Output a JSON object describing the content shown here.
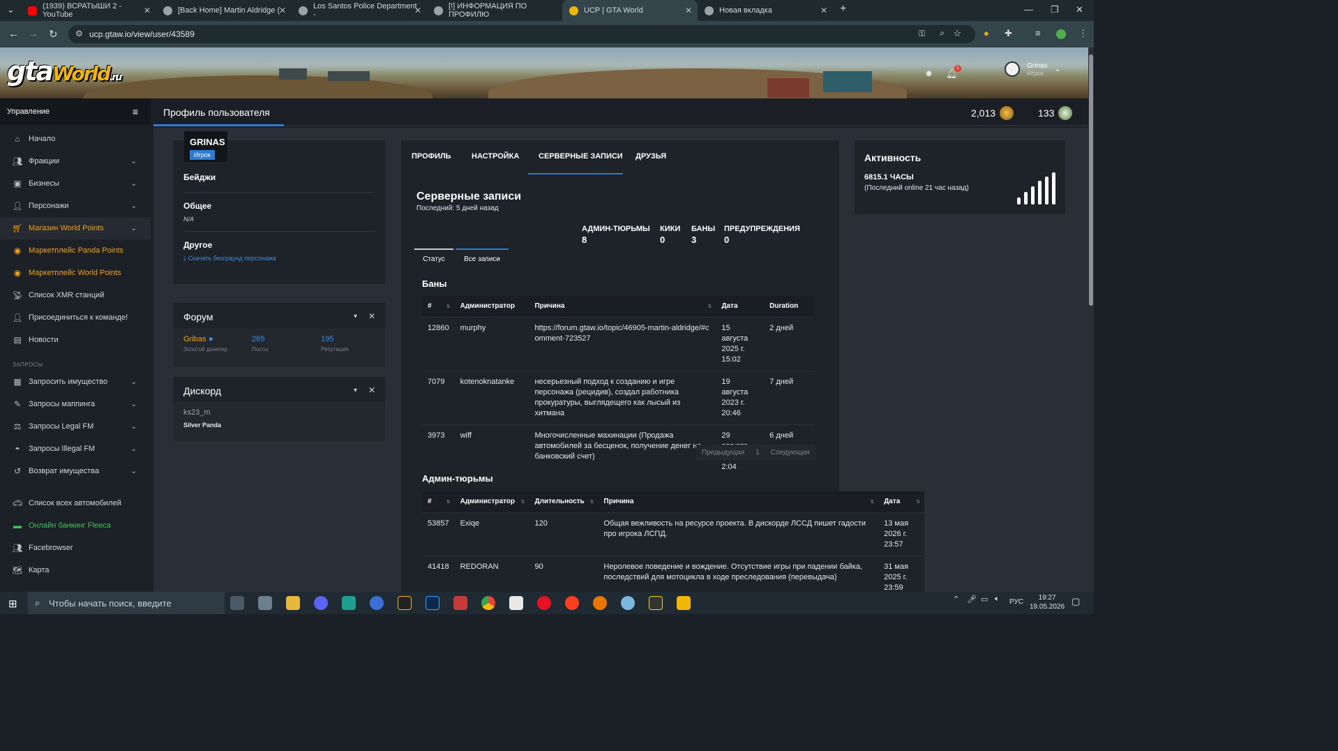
{
  "browser": {
    "tabs": [
      {
        "title": "(1939) ВСРАТЫШИ 2 - YouTube",
        "color": "#ff0000"
      },
      {
        "title": "[Back Home] Martin Aldridge (",
        "color": "#888888"
      },
      {
        "title": "Los Santos Police Department -",
        "color": "#888888"
      },
      {
        "title": "[!] ИНФОРМАЦИЯ ПО ПРОФИЛЮ",
        "color": "#888888"
      },
      {
        "title": "UCP | GTA World",
        "color": "#f2b705"
      },
      {
        "title": "Новая вкладка",
        "color": "#888888"
      }
    ],
    "url": "ucp.gtaw.io/view/user/43589"
  },
  "header": {
    "logo_main": "gta",
    "logo_world": "World",
    "logo_ru": ".ru",
    "notification_count": "1",
    "user_name": "Grinas",
    "user_role": "Игрок"
  },
  "sidebar": {
    "title": "Управление",
    "items": [
      {
        "label": "Начало",
        "icon": "home-icon",
        "chevron": false,
        "style": "normal"
      },
      {
        "label": "Фракции",
        "icon": "users-icon",
        "chevron": true,
        "style": "normal"
      },
      {
        "label": "Бизнесы",
        "icon": "briefcase-icon",
        "chevron": true,
        "style": "normal"
      },
      {
        "label": "Персонажи",
        "icon": "user-icon",
        "chevron": true,
        "style": "normal"
      },
      {
        "label": "Магазин World Points",
        "icon": "cart-icon",
        "chevron": true,
        "style": "orange"
      },
      {
        "label": "Маркетплейс Panda Points",
        "icon": "coins-icon",
        "chevron": false,
        "style": "orange"
      },
      {
        "label": "Маркетплейс World Points",
        "icon": "coins-icon",
        "chevron": false,
        "style": "orange"
      },
      {
        "label": "Список XMR станций",
        "icon": "antenna-icon",
        "chevron": false,
        "style": "normal"
      },
      {
        "label": "Присоединиться к команде!",
        "icon": "user-plus-icon",
        "chevron": false,
        "style": "normal"
      },
      {
        "label": "Новости",
        "icon": "newspaper-icon",
        "chevron": false,
        "style": "normal"
      }
    ],
    "section_requests": "ЗАПРОСЫ",
    "request_items": [
      {
        "label": "Запросить имущество",
        "icon": "building-icon",
        "chevron": true,
        "style": "normal"
      },
      {
        "label": "Запросы маппинга",
        "icon": "brush-icon",
        "chevron": true,
        "style": "normal"
      },
      {
        "label": "Запросы Legal FM",
        "icon": "scale-icon",
        "chevron": true,
        "style": "normal"
      },
      {
        "label": "Запросы Illegal FM",
        "icon": "mask-icon",
        "chevron": true,
        "style": "normal"
      },
      {
        "label": "Возврат имущества",
        "icon": "undo-icon",
        "chevron": true,
        "style": "normal"
      }
    ],
    "bottom_items": [
      {
        "label": "Список всех автомобилей",
        "icon": "car-icon",
        "style": "normal"
      },
      {
        "label": "Онлайн банкинг Fleeca",
        "icon": "money-icon",
        "style": "green"
      },
      {
        "label": "Facebrowser",
        "icon": "users-icon",
        "style": "normal"
      },
      {
        "label": "Карта",
        "icon": "map-icon",
        "style": "normal"
      }
    ]
  },
  "topbar": {
    "title": "Профиль пользователя",
    "world_points": "2,013",
    "panda_points": "133"
  },
  "profile": {
    "username": "GRINAS",
    "role": "Игрок",
    "badges_label": "Бейджи",
    "general_label": "Общее",
    "general_value": "N/A",
    "other_label": "Другое",
    "download_link": "Скачать бекграунд персонажа"
  },
  "forum": {
    "title": "Форум",
    "name": "Gribas",
    "rank": "Золотой донатер",
    "posts_value": "265",
    "posts_label": "Посты",
    "rep_value": "195",
    "rep_label": "Репутация"
  },
  "discord": {
    "title": "Дискорд",
    "name": "ks23_m",
    "role": "Silver Panda"
  },
  "tabs": [
    {
      "label": "ПРОФИЛЬ"
    },
    {
      "label": "НАСТРОЙКА"
    },
    {
      "label": "СЕРВЕРНЫЕ ЗАПИСИ"
    },
    {
      "label": "ДРУЗЬЯ"
    }
  ],
  "records": {
    "title": "Серверные записи",
    "last": "Последний: 5 дней назад",
    "counts": [
      {
        "label": "АДМИН-ТЮРЬМЫ",
        "value": "8"
      },
      {
        "label": "КИКИ",
        "value": "0"
      },
      {
        "label": "БАНЫ",
        "value": "3"
      },
      {
        "label": "ПРЕДУПРЕЖДЕНИЯ",
        "value": "0"
      }
    ],
    "subtabs": [
      "Статус",
      "Все записи"
    ],
    "bans_title": "Баны",
    "bans_headers": [
      "#",
      "Администратор",
      "Причина",
      "Дата",
      "Duration"
    ],
    "bans": [
      {
        "id": "12860",
        "admin": "murphy",
        "reason": "https://forum.gtaw.io/topic/46905-martin-aldridge/#comment-723527",
        "date": "15 августа 2025 г. 15:02",
        "duration": "2 дней"
      },
      {
        "id": "7079",
        "admin": "kotenoknatanke",
        "reason": "несерьезный подход к созданию и игре персонажа (рецидив), создал работника прокуратуры, выглядещего как лысый из хитмана",
        "date": "19 августа 2023 г. 20:46",
        "duration": "7 дней"
      },
      {
        "id": "3973",
        "admin": "wiff",
        "reason": "Многочисленные махинации (Продажа автомобилей за бесценок, получение денег на банковский счет)",
        "date": "29 августа 2022 г. 2:04",
        "duration": "6 дней"
      }
    ],
    "pager": {
      "prev": "Предыдущая",
      "page": "1",
      "next": "Следующая"
    },
    "jail_title": "Админ-тюрьмы",
    "jail_headers": [
      "#",
      "Администратор",
      "Длительность",
      "Причина",
      "Дата"
    ],
    "jails": [
      {
        "id": "53857",
        "admin": "Exiqe",
        "duration": "120",
        "reason": "Общая вежливость на ресурсе проекта. В дискорде ЛССД пишет гадости про игрока ЛСПД.",
        "date": "13 мая 2026 г. 23:57"
      },
      {
        "id": "41418",
        "admin": "REDORAN",
        "duration": "90",
        "reason": "Неролевое поведение и вождение. Отсутствие игры при падении байка, последствий для мотоцикла в ходе преследования (перевыдача)",
        "date": "31 мая 2025 г. 23:59"
      }
    ]
  },
  "activity": {
    "title": "Активность",
    "hours": "6815.1 ЧАСЫ",
    "last_online": "(Последний online 21 час назад)"
  },
  "taskbar": {
    "search_placeholder": "Чтобы начать поиск, введите",
    "lang": "РУС",
    "time": "19:27",
    "date": "19.05.2026"
  }
}
